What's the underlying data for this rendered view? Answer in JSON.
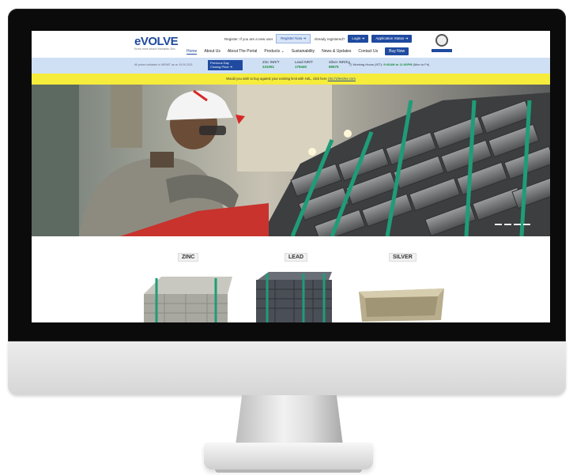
{
  "header": {
    "logo_text": "eVOLVE",
    "logo_tagline": "Know more about Hindustan Zinc",
    "register_prompt": "Register: If you are a new user",
    "register_button": "Register Now",
    "already_prompt": "Already registered?",
    "login_button": "Login",
    "app_status_button": "Application Status",
    "emblem_caption": "HINDUSTAN ZINC"
  },
  "nav": {
    "items": [
      {
        "label": "Home"
      },
      {
        "label": "About Us"
      },
      {
        "label": "About The Portal"
      },
      {
        "label": "Products"
      },
      {
        "label": "Sustainability"
      },
      {
        "label": "News & Updates"
      },
      {
        "label": "Contact Us"
      }
    ],
    "buy_button": "Buy Now"
  },
  "prices": {
    "note": "All prices indicated in INR/MT as on 19.09.2021",
    "previous_day": "Previous Day Closing Price",
    "zinc_label": "Zinc",
    "zinc_unit": "INR/T",
    "zinc_value": "231051",
    "lead_label": "Lead",
    "lead_unit": "INR/T",
    "lead_value": "179440",
    "silver_label": "Silver",
    "silver_unit": "INR/Kg",
    "silver_value": "69575",
    "hours_label": "Working Hours (IST):",
    "hours_value": "9:00AM to 11:00PM",
    "hours_days": "(Mon to Fri)"
  },
  "notice": {
    "text": "Would you wish to buy against your existing limit with HZL, click here",
    "link_text": "zinc.hzlevolve.com"
  },
  "hero": {
    "slides": 4,
    "active_slide": 1
  },
  "products": [
    {
      "label": "ZINC"
    },
    {
      "label": "LEAD"
    },
    {
      "label": "SILVER"
    }
  ],
  "colors": {
    "brand_blue": "#1f4aa0",
    "notice_yellow": "#f6ec3c",
    "price_green": "#1d8c3a",
    "strap_green": "#1f9c78"
  }
}
